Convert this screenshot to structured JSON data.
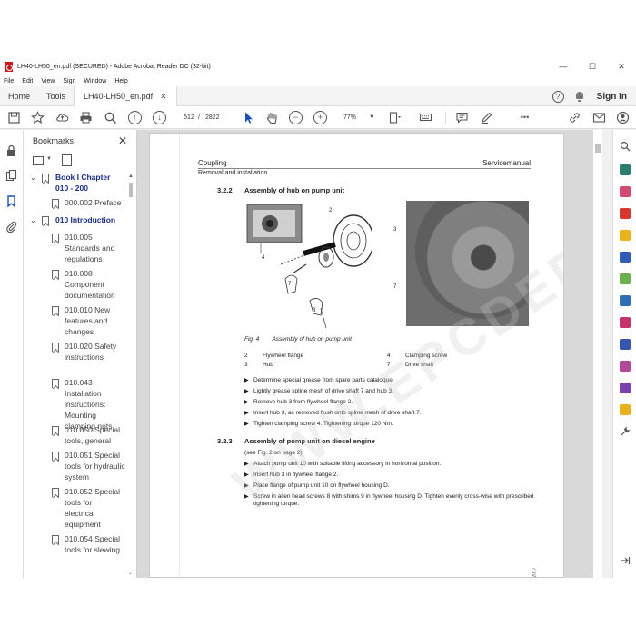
{
  "window": {
    "title": "LH40-LH50_en.pdf (SECURED) - Adobe Acrobat Reader DC (32-bit)",
    "minimize": "—",
    "maximize": "☐",
    "close": "✕"
  },
  "menu": [
    "File",
    "Edit",
    "View",
    "Sign",
    "Window",
    "Help"
  ],
  "tabs": {
    "home": "Home",
    "tools": "Tools",
    "document": "LH40-LH50_en.pdf",
    "close": "✕",
    "sign_in": "Sign In",
    "help": "?"
  },
  "toolbar": {
    "page_current": "512",
    "page_separator": "/",
    "page_total": "2822",
    "zoom": "77%",
    "more": "•••"
  },
  "bookmarks": {
    "title": "Bookmarks",
    "close": "✕",
    "items": [
      {
        "label": "Book I Chapter 010 - 200",
        "bold": true
      },
      {
        "label": "000.002 Preface"
      },
      {
        "label": "010 Introduction",
        "bold": true
      },
      {
        "label": "010.005 Standards and regulations"
      },
      {
        "label": "010.008 Component documentation"
      },
      {
        "label": "010.010 New features and changes"
      },
      {
        "label": "010.020 Safety instructions"
      },
      {
        "label": "010.043 Installation instructions: Mounting clamping nuts"
      },
      {
        "label": "010.050 Special tools, general"
      },
      {
        "label": "010.051 Special tools for hydraulic system"
      },
      {
        "label": "010.052 Special tools for electrical equipment"
      },
      {
        "label": "010.054 Special tools for slewing"
      }
    ]
  },
  "document": {
    "header_left": "Coupling",
    "header_right": "Servicemanual",
    "subheader": "Removal and installation",
    "watermark": "WWW.EPCDEPO.COM",
    "year": "2017",
    "section1": {
      "number": "3.2.2",
      "title": "Assembly of hub on pump unit",
      "figure_caption": "Fig. 4        Assembly of hub on pump unit",
      "callouts": [
        "2",
        "3",
        "4",
        "7",
        "3",
        "7"
      ],
      "legend": [
        {
          "num": "2",
          "text": "Flywheel flange"
        },
        {
          "num": "3",
          "text": "Hub"
        },
        {
          "num": "4",
          "text": "Clamping screw"
        },
        {
          "num": "7",
          "text": "Drive shaft"
        }
      ],
      "steps": [
        "Determine special grease from spare parts catalogue.",
        "Lightly grease spline mesh of drive shaft 7 and hub 3.",
        "Remove hub 3 from flywheel flange 2.",
        "Insert hub 3, as removed flush onto spline mesh of drive shaft 7.",
        "Tighten clamping screw 4. Tightening torque 120 Nm."
      ]
    },
    "section2": {
      "number": "3.2.3",
      "title": "Assembly of pump unit on diesel engine",
      "note": "(see Fig. 2 on page 2)",
      "steps": [
        "Attach pump unit 10 with suitable lifting accessory in horizontal position.",
        "Insert hub 3 in flywheel flange 2.",
        "Place flange of pump unit 10 on flywheel housing D.",
        "Screw in allen head screws 8 with shims 9 in flywheel housing D. Tighten evenly cross-wise with prescribed tightening torque."
      ]
    }
  },
  "colors": {
    "accent": "#1a2e8c",
    "pdf_red": "#d4161c",
    "doc_bg": "#d9d9d9"
  }
}
